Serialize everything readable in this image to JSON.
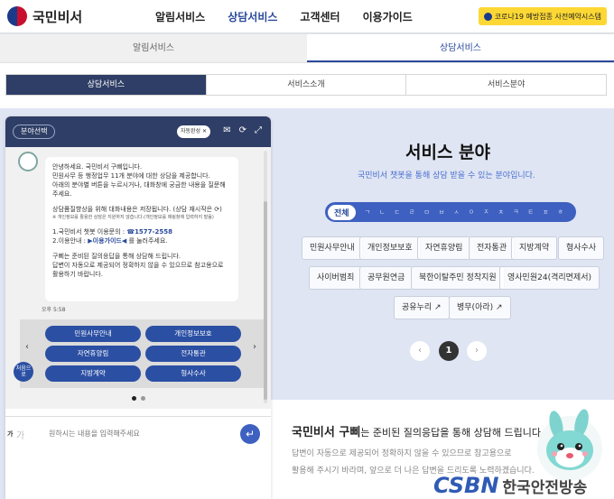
{
  "header": {
    "logo_text": "국민비서",
    "nav": [
      "알림서비스",
      "상담서비스",
      "고객센터",
      "이용가이드"
    ],
    "covid_button": "코로나19 예방접종 사전예약시스템"
  },
  "subnav": [
    "알림서비스",
    "상담서비스"
  ],
  "tabs": [
    "상담서비스",
    "서비스소개",
    "서비스분야"
  ],
  "service": {
    "title": "서비스 분야",
    "subtitle": "국민비서 챗봇을 통해 상담 받을 수 있는 분야입니다.",
    "all_label": "전체",
    "consonants": [
      "ㄱ",
      "ㄴ",
      "ㄷ",
      "ㄹ",
      "ㅁ",
      "ㅂ",
      "ㅅ",
      "ㅇ",
      "ㅈ",
      "ㅊ",
      "ㅋ",
      "ㅌ",
      "ㅍ",
      "ㅎ"
    ],
    "chips": [
      "민원사무안내",
      "개인정보보호",
      "자연휴양림",
      "전자통관",
      "지방계약",
      "형사수사",
      "사이버범죄",
      "공무원연금",
      "북한이탈주민 정착지원",
      "영사민원24(격리면제서)",
      "공유누리 ↗",
      "병무(아라) ↗"
    ],
    "page": "1"
  },
  "bottom": {
    "bold": "국민비서 구삐",
    "line1_rest": "는 준비된 질의응답을 통해 상담해 드립니다.",
    "line2": "답변이 자동으로 제공되어 정확하지 않을 수 있으므로 참고용으로",
    "line3": "활용해 주시기 바라며, 앞으로 더 나은 답변을 드리도록 노력하겠습니다."
  },
  "watermark": {
    "logo": "CSBN",
    "text": "한국안전방송"
  },
  "chat": {
    "select_label": "분야선택",
    "auto_label": "자동완성 ✕",
    "msg": {
      "l1": "안녕하세요. 국민비서 구삐입니다.",
      "l2": "민원사무 등 행정업무 11개 분야에 대한 상담을 제공합니다.",
      "l3": "아래의 분야별 버튼을 누르시거나, 대화창에 궁금한 내용을 질문해",
      "l4": "주세요.",
      "l5": "상담품질향상을 위해 대화내용은 저장됩니다. (상담 재시작은 ⟳)",
      "l6": "※ 개인정보를 활용한 상담은 지원하지 않습니다.(개인정보를 제링창에 입력하지 말음)",
      "l7a": "1.국민비서 챗봇 이용문의 : ",
      "l7b": "☎1577-2558",
      "l8a": "2.이용안내 : ",
      "l8b": "▶이용가이드◀",
      "l8c": " 를 눌러주세요.",
      "l9": "구삐는 준비된 질의응답을 통해 상담해 드립니다.",
      "l10": "답변이 자동으로 제공되어 정확하지 않을 수 있으므로 참고용으로",
      "l11": "활용하기 바랍니다."
    },
    "time": "오후 5:58",
    "menu": [
      "민원사무안내",
      "개인정보보호",
      "자연휴양림",
      "전자통관",
      "지방계약",
      "형사수사"
    ],
    "first_label": "처음으로",
    "input_prefix": "가",
    "input_prefix2": "가",
    "input_placeholder": "원하시는 내용을 입력해주세요"
  }
}
